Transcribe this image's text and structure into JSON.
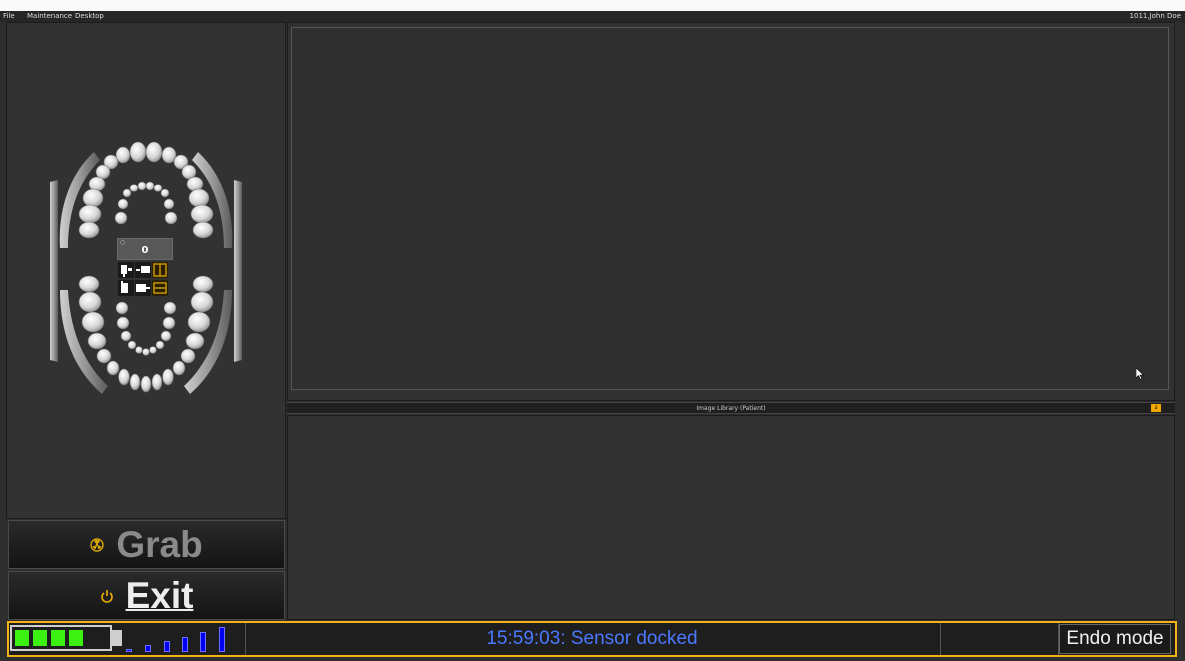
{
  "menu": {
    "items": [
      "File",
      "Maintenance",
      "Desktop"
    ],
    "user": "1011,John Doe"
  },
  "tooth_chart": {
    "counter": "0",
    "small_mark": "○"
  },
  "buttons": {
    "grab_label": "Grab",
    "exit_label": "Exit"
  },
  "library": {
    "title": "Image Library (Patient)",
    "expand_icon": "↓"
  },
  "status": {
    "message": "15:59:03: Sensor docked",
    "endo_mode_label": "Endo mode",
    "battery_cells": 4,
    "signal_bars": 6
  },
  "colors": {
    "accent": "#f2b414",
    "status_text": "#4a78ff",
    "battery_green": "#3cf012",
    "signal_blue": "#0000f0"
  }
}
